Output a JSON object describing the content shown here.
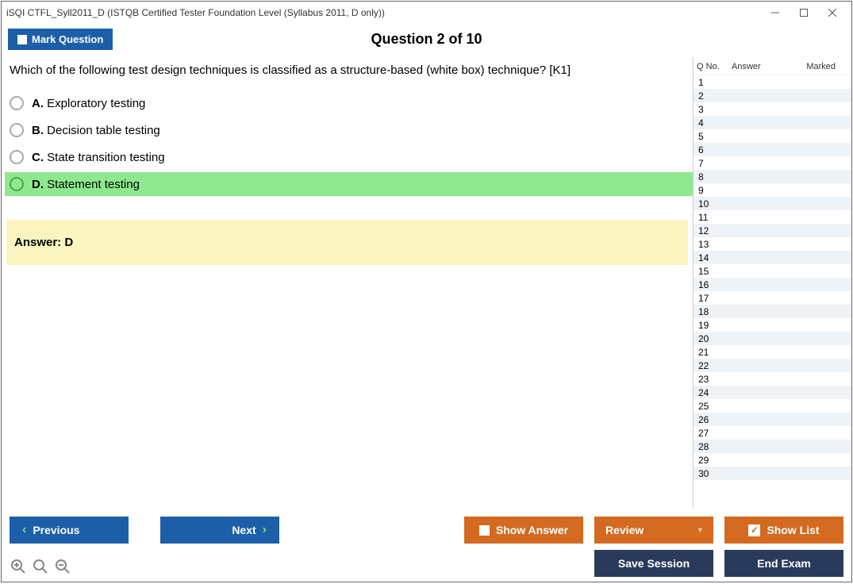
{
  "window_title": "iSQI CTFL_Syll2011_D (ISTQB Certified Tester Foundation Level (Syllabus 2011, D only))",
  "toolbar": {
    "mark_label": "Mark Question",
    "question_counter": "Question 2 of 10"
  },
  "question_text": "Which of the following test design techniques is classified as a structure-based (white box) technique? [K1]",
  "options": [
    {
      "letter": "A.",
      "text": "Exploratory testing",
      "correct": false
    },
    {
      "letter": "B.",
      "text": "Decision table testing",
      "correct": false
    },
    {
      "letter": "C.",
      "text": "State transition testing",
      "correct": false
    },
    {
      "letter": "D.",
      "text": "Statement testing",
      "correct": true
    }
  ],
  "answer_label": "Answer: D",
  "side": {
    "head_qno": "Q No.",
    "head_answer": "Answer",
    "head_marked": "Marked",
    "rows_count": 30
  },
  "buttons": {
    "previous": "Previous",
    "next": "Next",
    "show_answer": "Show Answer",
    "review": "Review",
    "show_list": "Show List",
    "save_session": "Save Session",
    "end_exam": "End Exam"
  }
}
